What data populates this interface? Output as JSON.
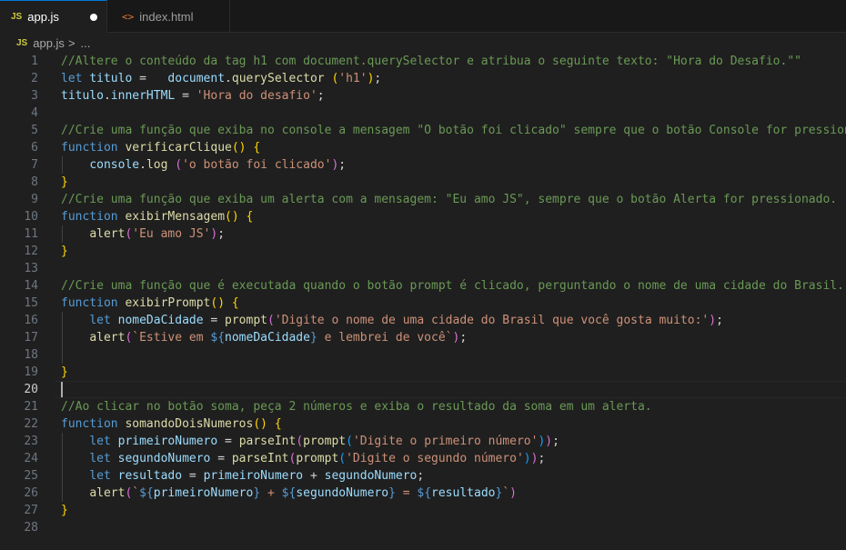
{
  "tabs": [
    {
      "icon": "JS",
      "label": "app.js",
      "modified": true
    },
    {
      "icon": "<>",
      "label": "index.html"
    }
  ],
  "breadcrumb": {
    "icon": "JS",
    "file": "app.js",
    "separator": ">",
    "more": "..."
  },
  "editor": {
    "current_line": 20,
    "lines": [
      {
        "n": "1",
        "tokens": [
          {
            "t": "//Altere o conteúdo da tag h1 com document.querySelector e atribua o seguinte texto: \"Hora do Desafio.\"\"",
            "c": "c"
          }
        ]
      },
      {
        "n": "2",
        "tokens": [
          {
            "t": "let ",
            "c": "k"
          },
          {
            "t": "titulo",
            "c": "v"
          },
          {
            "t": " =   ",
            "c": "p"
          },
          {
            "t": "document",
            "c": "v"
          },
          {
            "t": ".",
            "c": "p"
          },
          {
            "t": "querySelector",
            "c": "f"
          },
          {
            "t": " ",
            "c": "p"
          },
          {
            "t": "(",
            "c": "b1"
          },
          {
            "t": "'h1'",
            "c": "s"
          },
          {
            "t": ")",
            "c": "b1"
          },
          {
            "t": ";",
            "c": "p"
          }
        ]
      },
      {
        "n": "3",
        "tokens": [
          {
            "t": "titulo",
            "c": "v"
          },
          {
            "t": ".",
            "c": "p"
          },
          {
            "t": "innerHTML",
            "c": "v"
          },
          {
            "t": " = ",
            "c": "p"
          },
          {
            "t": "'Hora do desafio'",
            "c": "s"
          },
          {
            "t": ";",
            "c": "p"
          }
        ]
      },
      {
        "n": "4",
        "tokens": []
      },
      {
        "n": "5",
        "tokens": [
          {
            "t": "//Crie uma função que exiba no console a mensagem \"O botão foi clicado\" sempre que o botão Console for pressionado",
            "c": "c"
          }
        ]
      },
      {
        "n": "6",
        "tokens": [
          {
            "t": "function ",
            "c": "k"
          },
          {
            "t": "verificarClique",
            "c": "f"
          },
          {
            "t": "()",
            "c": "b1"
          },
          {
            "t": " ",
            "c": "p"
          },
          {
            "t": "{",
            "c": "b1"
          }
        ]
      },
      {
        "n": "7",
        "tokens": [
          {
            "t": "    ",
            "c": "p"
          },
          {
            "t": "console",
            "c": "v"
          },
          {
            "t": ".",
            "c": "p"
          },
          {
            "t": "log",
            "c": "f"
          },
          {
            "t": " ",
            "c": "p"
          },
          {
            "t": "(",
            "c": "b2"
          },
          {
            "t": "'o botão foi clicado'",
            "c": "s"
          },
          {
            "t": ")",
            "c": "b2"
          },
          {
            "t": ";",
            "c": "p"
          }
        ]
      },
      {
        "n": "8",
        "tokens": [
          {
            "t": "}",
            "c": "b1"
          }
        ]
      },
      {
        "n": "9",
        "tokens": [
          {
            "t": "//Crie uma função que exiba um alerta com a mensagem: \"Eu amo JS\", sempre que o botão Alerta for pressionado.",
            "c": "c"
          }
        ]
      },
      {
        "n": "10",
        "tokens": [
          {
            "t": "function ",
            "c": "k"
          },
          {
            "t": "exibirMensagem",
            "c": "f"
          },
          {
            "t": "()",
            "c": "b1"
          },
          {
            "t": " ",
            "c": "p"
          },
          {
            "t": "{",
            "c": "b1"
          }
        ]
      },
      {
        "n": "11",
        "tokens": [
          {
            "t": "    ",
            "c": "p"
          },
          {
            "t": "alert",
            "c": "f"
          },
          {
            "t": "(",
            "c": "b2"
          },
          {
            "t": "'Eu amo JS'",
            "c": "s"
          },
          {
            "t": ")",
            "c": "b2"
          },
          {
            "t": ";",
            "c": "p"
          }
        ]
      },
      {
        "n": "12",
        "tokens": [
          {
            "t": "}",
            "c": "b1"
          }
        ]
      },
      {
        "n": "13",
        "tokens": []
      },
      {
        "n": "14",
        "tokens": [
          {
            "t": "//Crie uma função que é executada quando o botão prompt é clicado, perguntando o nome de uma cidade do Brasil.",
            "c": "c"
          }
        ]
      },
      {
        "n": "15",
        "tokens": [
          {
            "t": "function ",
            "c": "k"
          },
          {
            "t": "exibirPrompt",
            "c": "f"
          },
          {
            "t": "()",
            "c": "b1"
          },
          {
            "t": " ",
            "c": "p"
          },
          {
            "t": "{",
            "c": "b1"
          }
        ]
      },
      {
        "n": "16",
        "tokens": [
          {
            "t": "    ",
            "c": "p"
          },
          {
            "t": "let ",
            "c": "k"
          },
          {
            "t": "nomeDaCidade",
            "c": "v"
          },
          {
            "t": " = ",
            "c": "p"
          },
          {
            "t": "prompt",
            "c": "f"
          },
          {
            "t": "(",
            "c": "b2"
          },
          {
            "t": "'Digite o nome de uma cidade do Brasil que você gosta muito:'",
            "c": "s"
          },
          {
            "t": ")",
            "c": "b2"
          },
          {
            "t": ";",
            "c": "p"
          }
        ]
      },
      {
        "n": "17",
        "tokens": [
          {
            "t": "    ",
            "c": "p"
          },
          {
            "t": "alert",
            "c": "f"
          },
          {
            "t": "(",
            "c": "b2"
          },
          {
            "t": "`Estive em ",
            "c": "s"
          },
          {
            "t": "${",
            "c": "t"
          },
          {
            "t": "nomeDaCidade",
            "c": "v"
          },
          {
            "t": "}",
            "c": "t"
          },
          {
            "t": " e lembrei de você`",
            "c": "s"
          },
          {
            "t": ")",
            "c": "b2"
          },
          {
            "t": ";",
            "c": "p"
          }
        ]
      },
      {
        "n": "18",
        "tokens": []
      },
      {
        "n": "19",
        "tokens": [
          {
            "t": "}",
            "c": "b1"
          }
        ]
      },
      {
        "n": "20",
        "tokens": []
      },
      {
        "n": "21",
        "tokens": [
          {
            "t": "//Ao clicar no botão soma, peça 2 números e exiba o resultado da soma em um alerta.",
            "c": "c"
          }
        ]
      },
      {
        "n": "22",
        "tokens": [
          {
            "t": "function ",
            "c": "k"
          },
          {
            "t": "somandoDoisNumeros",
            "c": "f"
          },
          {
            "t": "()",
            "c": "b1"
          },
          {
            "t": " ",
            "c": "p"
          },
          {
            "t": "{",
            "c": "b1"
          }
        ]
      },
      {
        "n": "23",
        "tokens": [
          {
            "t": "    ",
            "c": "p"
          },
          {
            "t": "let ",
            "c": "k"
          },
          {
            "t": "primeiroNumero",
            "c": "v"
          },
          {
            "t": " = ",
            "c": "p"
          },
          {
            "t": "parseInt",
            "c": "f"
          },
          {
            "t": "(",
            "c": "b2"
          },
          {
            "t": "prompt",
            "c": "f"
          },
          {
            "t": "(",
            "c": "b3"
          },
          {
            "t": "'Digite o primeiro número'",
            "c": "s"
          },
          {
            "t": ")",
            "c": "b3"
          },
          {
            "t": ")",
            "c": "b2"
          },
          {
            "t": ";",
            "c": "p"
          }
        ]
      },
      {
        "n": "24",
        "tokens": [
          {
            "t": "    ",
            "c": "p"
          },
          {
            "t": "let ",
            "c": "k"
          },
          {
            "t": "segundoNumero",
            "c": "v"
          },
          {
            "t": " = ",
            "c": "p"
          },
          {
            "t": "parseInt",
            "c": "f"
          },
          {
            "t": "(",
            "c": "b2"
          },
          {
            "t": "prompt",
            "c": "f"
          },
          {
            "t": "(",
            "c": "b3"
          },
          {
            "t": "'Digite o segundo número'",
            "c": "s"
          },
          {
            "t": ")",
            "c": "b3"
          },
          {
            "t": ")",
            "c": "b2"
          },
          {
            "t": ";",
            "c": "p"
          }
        ]
      },
      {
        "n": "25",
        "tokens": [
          {
            "t": "    ",
            "c": "p"
          },
          {
            "t": "let ",
            "c": "k"
          },
          {
            "t": "resultado",
            "c": "v"
          },
          {
            "t": " = ",
            "c": "p"
          },
          {
            "t": "primeiroNumero",
            "c": "v"
          },
          {
            "t": " + ",
            "c": "p"
          },
          {
            "t": "segundoNumero",
            "c": "v"
          },
          {
            "t": ";",
            "c": "p"
          }
        ]
      },
      {
        "n": "26",
        "tokens": [
          {
            "t": "    ",
            "c": "p"
          },
          {
            "t": "alert",
            "c": "f"
          },
          {
            "t": "(",
            "c": "b2"
          },
          {
            "t": "`",
            "c": "s"
          },
          {
            "t": "${",
            "c": "t"
          },
          {
            "t": "primeiroNumero",
            "c": "v"
          },
          {
            "t": "}",
            "c": "t"
          },
          {
            "t": " + ",
            "c": "s"
          },
          {
            "t": "${",
            "c": "t"
          },
          {
            "t": "segundoNumero",
            "c": "v"
          },
          {
            "t": "}",
            "c": "t"
          },
          {
            "t": " = ",
            "c": "s"
          },
          {
            "t": "${",
            "c": "t"
          },
          {
            "t": "resultado",
            "c": "v"
          },
          {
            "t": "}",
            "c": "t"
          },
          {
            "t": "`",
            "c": "s"
          },
          {
            "t": ")",
            "c": "b2"
          }
        ]
      },
      {
        "n": "27",
        "tokens": [
          {
            "t": "}",
            "c": "b1"
          }
        ]
      },
      {
        "n": "28",
        "tokens": []
      }
    ]
  }
}
